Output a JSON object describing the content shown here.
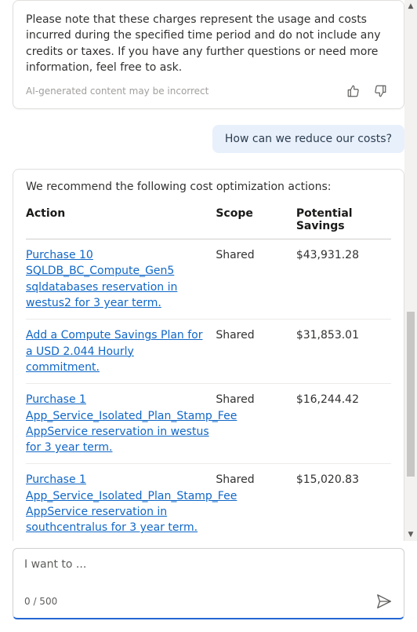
{
  "messages": {
    "note": {
      "text": "Please note that these charges represent the usage and costs incurred during the specified time period and do not include any credits or taxes. If you have any further questions or need more information, feel free to ask.",
      "disclaimer": "AI-generated content may be incorrect"
    },
    "user_question": "How can we reduce our costs?",
    "recommendation_intro": "We recommend the following cost optimization actions:",
    "table": {
      "headers": {
        "action": "Action",
        "scope": "Scope",
        "savings": "Potential Savings"
      },
      "rows": [
        {
          "action": "Purchase 10 SQLDB_BC_Compute_Gen5 sqldatabases reservation in westus2 for 3 year term.",
          "scope": "Shared",
          "savings": "$43,931.28"
        },
        {
          "action": "Add a Compute Savings Plan for a USD 2.044 Hourly commitment.",
          "scope": "Shared",
          "savings": "$31,853.01"
        },
        {
          "action": "Purchase 1 App_Service_Isolated_Plan_Stamp_Fee AppService reservation in westus for 3 year term.",
          "scope": "Shared",
          "savings": "$16,244.42"
        },
        {
          "action": "Purchase 1 App_Service_Isolated_Plan_Stamp_Fee AppService reservation in southcentralus for 3 year term.",
          "scope": "Shared",
          "savings": "$15,020.83"
        }
      ]
    }
  },
  "input": {
    "placeholder": "I want to ...",
    "char_count": "0 / 500"
  },
  "icons": {
    "thumbs_up": "thumbs-up-icon",
    "thumbs_down": "thumbs-down-icon",
    "send": "send-icon"
  }
}
